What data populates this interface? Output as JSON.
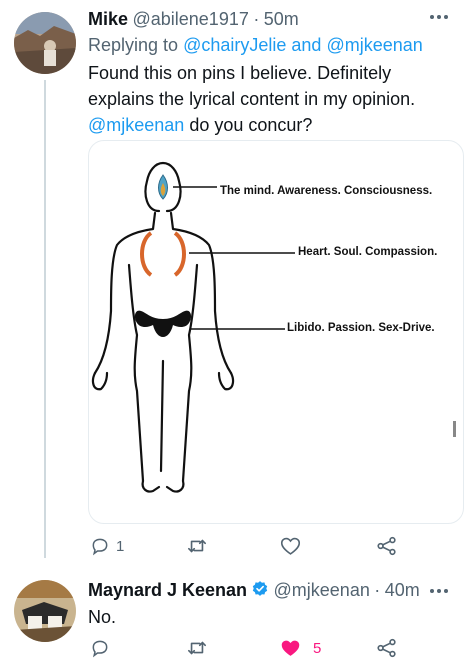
{
  "tweet1": {
    "name": "Mike",
    "handle": "@abilene1917",
    "sep": "·",
    "time": "50m",
    "replying_prefix": "Replying to",
    "replying_user1": "@chairyJelie",
    "replying_and": "and",
    "replying_user2": "@mjkeenan",
    "text_line1": "Found this on pins I believe. Definitely",
    "text_line2": "explains the lyrical content in my opinion.",
    "text_mention": "@mjkeenan",
    "text_end": "do you concur?",
    "image": {
      "label_mind": "The mind. Awareness. Consciousness.",
      "label_heart": "Heart. Soul. Compassion.",
      "label_libido": "Libido. Passion. Sex-Drive."
    },
    "actions": {
      "reply_count": "1",
      "retweet_count": "",
      "like_count": ""
    }
  },
  "tweet2": {
    "name": "Maynard J Keenan",
    "handle": "@mjkeenan",
    "sep": "·",
    "time": "40m",
    "text": "No.",
    "actions": {
      "reply_count": "",
      "retweet_count": "",
      "like_count": "5"
    }
  },
  "colors": {
    "accent": "#1d9bf0",
    "like": "#f91880",
    "muted": "#536471"
  }
}
